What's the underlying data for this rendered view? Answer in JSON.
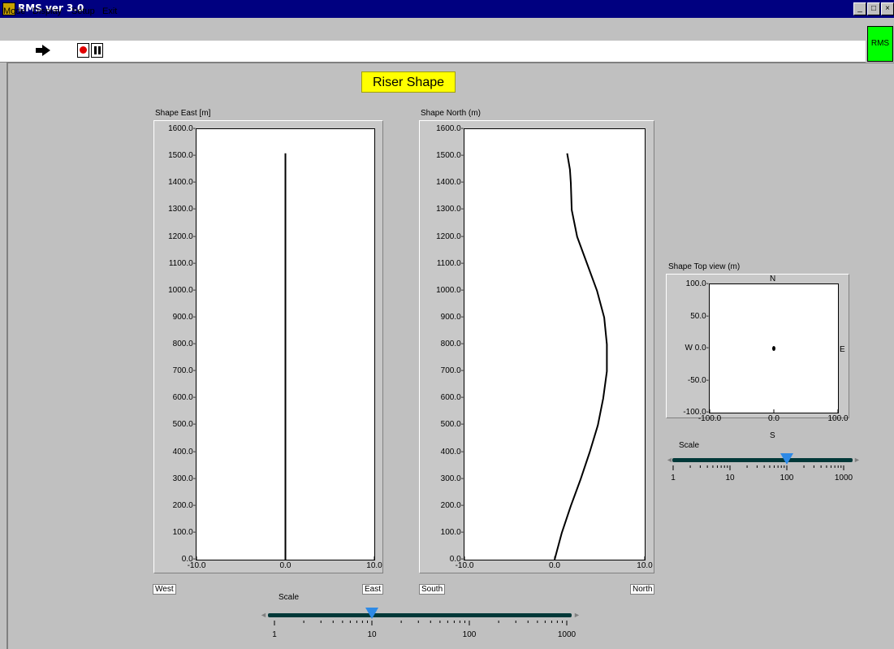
{
  "window": {
    "title": "RMS ver 3.0",
    "controls": [
      "_",
      "□",
      "×"
    ]
  },
  "menu": [
    {
      "label": "Mode"
    },
    {
      "label": "Display"
    },
    {
      "label": "Setup"
    },
    {
      "label": "Exit"
    }
  ],
  "toolbar": {
    "run_icon": "run-arrow-icon",
    "record_icon": "record-icon",
    "pause_icon": "pause-icon"
  },
  "status_indicator": {
    "label": "RMS",
    "color": "#00ff00"
  },
  "panel_title": "Riser Shape",
  "chart_data": [
    {
      "type": "line",
      "title": "Shape East [m]",
      "xlim": [
        -10.0,
        10.0
      ],
      "ylim": [
        0.0,
        1600.0
      ],
      "x_ticks": [
        "-10.0",
        "0.0",
        "10.0"
      ],
      "y_ticks": [
        "0.0",
        "100.0",
        "200.0",
        "300.0",
        "400.0",
        "500.0",
        "600.0",
        "700.0",
        "800.0",
        "900.0",
        "1000.0",
        "1100.0",
        "1200.0",
        "1300.0",
        "1400.0",
        "1500.0",
        "1600.0"
      ],
      "left_label": "West",
      "right_label": "East",
      "series": [
        {
          "x": [
            0.0,
            0.0
          ],
          "y": [
            0,
            1510
          ]
        }
      ]
    },
    {
      "type": "line",
      "title": "Shape North (m)",
      "xlim": [
        -10.0,
        10.0
      ],
      "ylim": [
        0.0,
        1600.0
      ],
      "x_ticks": [
        "-10.0",
        "0.0",
        "10.0"
      ],
      "y_ticks": [
        "0.0",
        "100.0",
        "200.0",
        "300.0",
        "400.0",
        "500.0",
        "600.0",
        "700.0",
        "800.0",
        "900.0",
        "1000.0",
        "1100.0",
        "1200.0",
        "1300.0",
        "1400.0",
        "1500.0",
        "1600.0"
      ],
      "left_label": "South",
      "right_label": "North",
      "series": [
        {
          "x": [
            0.0,
            0.8,
            1.8,
            2.9,
            3.9,
            4.8,
            5.4,
            5.8,
            5.8,
            5.5,
            4.7,
            3.6,
            2.5,
            1.9,
            1.8,
            1.7,
            1.4
          ],
          "y": [
            0,
            100,
            200,
            300,
            400,
            500,
            600,
            700,
            800,
            900,
            1000,
            1100,
            1200,
            1300,
            1400,
            1450,
            1510
          ]
        }
      ]
    },
    {
      "type": "scatter",
      "title": "Shape Top view (m)",
      "xlim": [
        -100.0,
        100.0
      ],
      "ylim": [
        -100.0,
        100.0
      ],
      "x_ticks": [
        "-100.0",
        "0.0",
        "100.0"
      ],
      "y_ticks": [
        "-100.0",
        "-50.0",
        "W 0.0",
        "50.0",
        "100.0"
      ],
      "compass": {
        "n": "N",
        "s": "S",
        "e": "E"
      },
      "series": [
        {
          "x": [
            0.0
          ],
          "y": [
            0.0
          ]
        }
      ]
    }
  ],
  "scales": {
    "main": {
      "label": "Scale",
      "ticks": [
        "1",
        "10",
        "100",
        "1000"
      ],
      "value": 10
    },
    "top_view": {
      "label": "Scale",
      "ticks": [
        "1",
        "10",
        "100",
        "1000"
      ],
      "value": 100
    }
  }
}
